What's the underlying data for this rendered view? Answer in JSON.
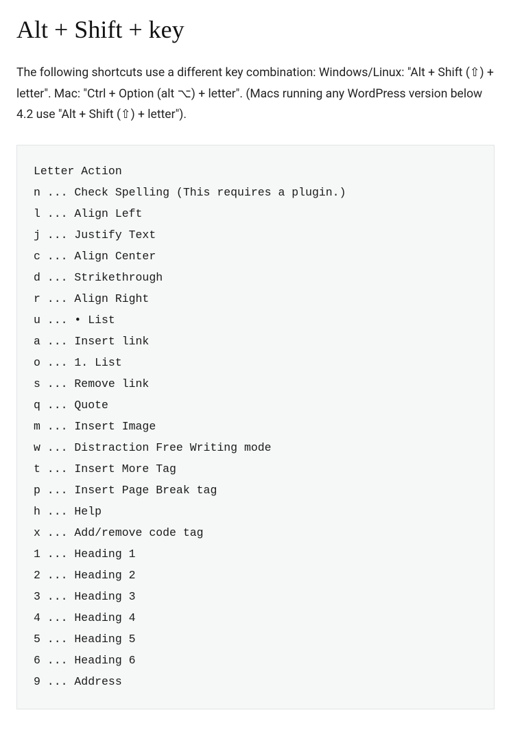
{
  "heading": "Alt + Shift + key",
  "description": "The following shortcuts use a different key combination: Windows/Linux: \"Alt + Shift (⇧) + letter\". Mac: \"Ctrl + Option (alt ⌥) + letter\". (Macs running any WordPress version below 4.2 use \"Alt + Shift (⇧) + letter\").",
  "code": {
    "header": "Letter Action",
    "rows": [
      {
        "key": "n",
        "action": "Check Spelling (This requires a plugin.)"
      },
      {
        "key": "l",
        "action": "Align Left"
      },
      {
        "key": "j",
        "action": "Justify Text"
      },
      {
        "key": "c",
        "action": "Align Center"
      },
      {
        "key": "d",
        "action": "Strikethrough"
      },
      {
        "key": "r",
        "action": "Align Right"
      },
      {
        "key": "u",
        "action": "• List"
      },
      {
        "key": "a",
        "action": "Insert link"
      },
      {
        "key": "o",
        "action": "1. List"
      },
      {
        "key": "s",
        "action": "Remove link"
      },
      {
        "key": "q",
        "action": "Quote"
      },
      {
        "key": "m",
        "action": "Insert Image"
      },
      {
        "key": "w",
        "action": "Distraction Free Writing mode"
      },
      {
        "key": "t",
        "action": "Insert More Tag"
      },
      {
        "key": "p",
        "action": "Insert Page Break tag"
      },
      {
        "key": "h",
        "action": "Help"
      },
      {
        "key": "x",
        "action": "Add/remove code tag"
      },
      {
        "key": "1",
        "action": "Heading 1"
      },
      {
        "key": "2",
        "action": "Heading 2"
      },
      {
        "key": "3",
        "action": "Heading 3"
      },
      {
        "key": "4",
        "action": "Heading 4"
      },
      {
        "key": "5",
        "action": "Heading 5"
      },
      {
        "key": "6",
        "action": "Heading 6"
      },
      {
        "key": "9",
        "action": "Address"
      }
    ]
  }
}
